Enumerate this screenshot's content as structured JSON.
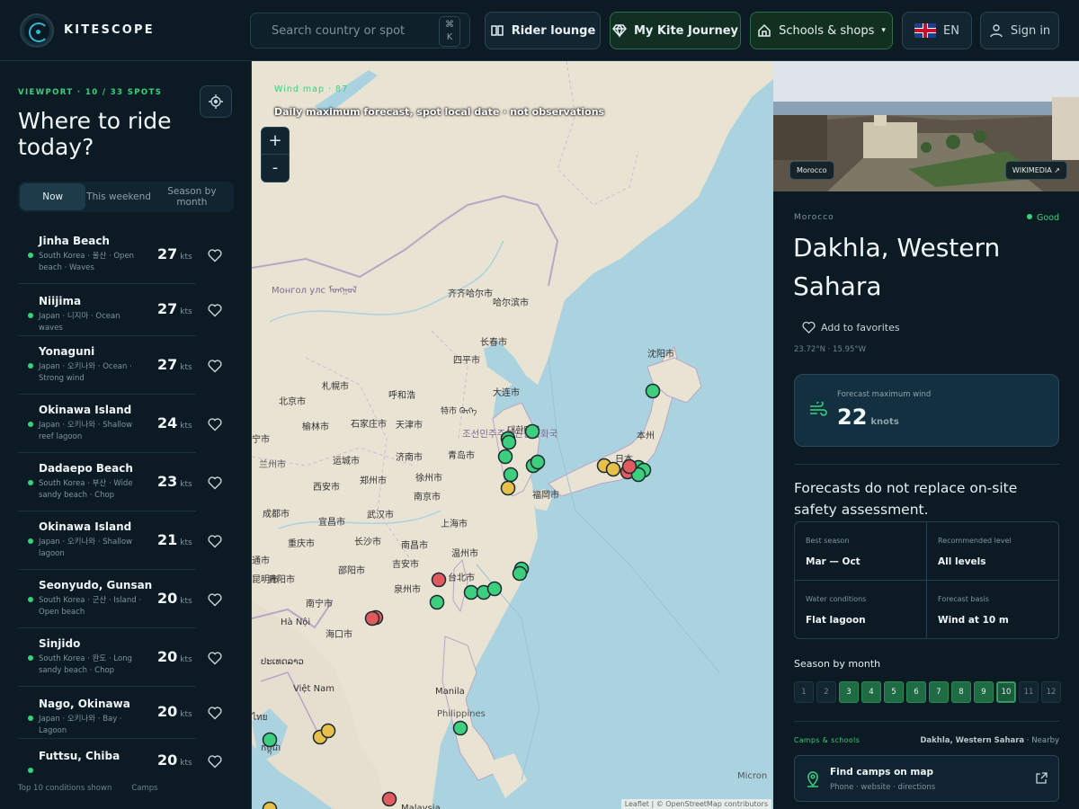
{
  "brand": {
    "name": "KITESCOPE"
  },
  "search": {
    "placeholder": "Search country or spot",
    "shortcut_line1": "⌘",
    "shortcut_line2": "K"
  },
  "nav": {
    "rider_lounge": "Rider lounge",
    "kite_journey": "My Kite Journey",
    "schools": "Schools & shops",
    "language": "EN",
    "sign_in": "Sign in"
  },
  "left": {
    "viewport": "VIEWPORT · 10 / 33 SPOTS",
    "heading": "Where to ride today?",
    "tabs": [
      "Now",
      "This weekend",
      "Season by month"
    ],
    "unit": "kts",
    "spots": [
      {
        "name": "Jinha Beach",
        "sub": "South Korea · 울산 · Open beach · Waves",
        "kts": "27"
      },
      {
        "name": "Niijima",
        "sub": "Japan · 니지마 · Ocean waves",
        "kts": "27"
      },
      {
        "name": "Yonaguni",
        "sub": "Japan · 오키나와 · Ocean · Strong wind",
        "kts": "27"
      },
      {
        "name": "Okinawa Island",
        "sub": "Japan · 오키나와 · Shallow reef lagoon",
        "kts": "24"
      },
      {
        "name": "Dadaepo Beach",
        "sub": "South Korea · 부산 · Wide sandy beach · Chop",
        "kts": "23"
      },
      {
        "name": "Okinawa Island",
        "sub": "Japan · 오키나와 · Shallow lagoon",
        "kts": "21"
      },
      {
        "name": "Seonyudo, Gunsan",
        "sub": "South Korea · 군산 · Island · Open beach",
        "kts": "20"
      },
      {
        "name": "Sinjido",
        "sub": "South Korea · 완도 · Long sandy beach · Chop",
        "kts": "20"
      },
      {
        "name": "Nago, Okinawa",
        "sub": "Japan · 오키나와 · Bay · Lagoon",
        "kts": "20"
      },
      {
        "name": "Futtsu, Chiba",
        "sub": "",
        "kts": "20"
      }
    ],
    "footer_shown": "Top 10 conditions shown",
    "footer_camps": "Camps"
  },
  "map": {
    "title": "Wind map · 87",
    "subtitle": "Daily maximum forecast, spot local date · not observations",
    "zoom_in": "+",
    "zoom_out": "-",
    "attribution": "Leaflet | © OpenStreetMap contributors",
    "labels": [
      "Монгол улс ᠮᠣᠩᠭᠣᠯ",
      "齐齐哈尔市",
      "哈尔滨市",
      "长春市",
      "四平市",
      "沈阳市",
      "札幌市",
      "呼和浩",
      "北京市",
      "特市 ᠬᠥᠬᠡ",
      "大连市",
      "조선민주주의인민공화국",
      "榆林市",
      "石家庄市",
      "天津市",
      "宁市",
      "兰州市",
      "运城市",
      "济南市",
      "青岛市",
      "西安市",
      "郑州市",
      "徐州市",
      "南京市",
      "福岡市",
      "日本",
      "本州",
      "成都市",
      "宜昌市",
      "武汉市",
      "上海市",
      "重庆市",
      "长沙市",
      "南昌市",
      "温州市",
      "貴阳市",
      "邵阳市",
      "吉安市",
      "通市",
      "昆明市",
      "台北市",
      "泉州市",
      "南宁市",
      "Hà Nội",
      "海口市",
      "ປະເທດລາວ",
      "Việt Nam",
      "Manila",
      "Philippines",
      "Micron",
      "Malaysia",
      "ไทย",
      "កម្ពុជា",
      "대한민국"
    ],
    "markers": [
      {
        "status": "good"
      },
      {
        "status": "good"
      },
      {
        "status": "good"
      },
      {
        "status": "good"
      },
      {
        "status": "good"
      },
      {
        "status": "good"
      },
      {
        "status": "good"
      },
      {
        "status": "fair"
      },
      {
        "status": "good"
      },
      {
        "status": "good"
      },
      {
        "status": "fair"
      },
      {
        "status": "fair"
      },
      {
        "status": "poor"
      },
      {
        "status": "good"
      },
      {
        "status": "good"
      },
      {
        "status": "good"
      },
      {
        "status": "good"
      },
      {
        "status": "good"
      },
      {
        "status": "poor"
      },
      {
        "status": "good"
      },
      {
        "status": "good"
      },
      {
        "status": "good"
      },
      {
        "status": "good"
      },
      {
        "status": "poor"
      },
      {
        "status": "poor"
      },
      {
        "status": "good"
      },
      {
        "status": "fair"
      },
      {
        "status": "fair"
      },
      {
        "status": "good"
      },
      {
        "status": "fair"
      },
      {
        "status": "poor"
      },
      {
        "status": "poor"
      }
    ]
  },
  "right": {
    "photo_chip": "Morocco",
    "photo_credit": "WIKIMEDIA ↗",
    "country": "Morocco",
    "status": "Good",
    "title": "Dakhla, Western Sahara",
    "favorite": "Add to favorites",
    "coords": "23.72°N · 15.95°W",
    "wind_label": "Forecast maximum wind",
    "wind_value": "22",
    "wind_unit": "knots",
    "note": "Forecasts do not replace on-site safety assessment.",
    "facts": [
      {
        "k": "Best season",
        "v": "Mar — Oct"
      },
      {
        "k": "Recommended level",
        "v": "All levels"
      },
      {
        "k": "Water conditions",
        "v": "Flat lagoon"
      },
      {
        "k": "Forecast basis",
        "v": "Wind at 10 m"
      }
    ],
    "season_title": "Season by month",
    "months": [
      "1",
      "2",
      "3",
      "4",
      "5",
      "6",
      "7",
      "8",
      "9",
      "10",
      "11",
      "12"
    ],
    "good_months": [
      3,
      4,
      5,
      6,
      7,
      8,
      9,
      10
    ],
    "current_month": 10,
    "camps_label": "Camps & schools",
    "camps_place": "Dakhla, Western Sahara",
    "camps_nearby": "Nearby",
    "find_title": "Find camps on map",
    "find_sub": "Phone · website · directions"
  },
  "colors": {
    "good": "#3ecf7e",
    "fair": "#e6c04a",
    "poor": "#e05a5e",
    "accent": "#36d27e",
    "water": "#aad3df"
  }
}
